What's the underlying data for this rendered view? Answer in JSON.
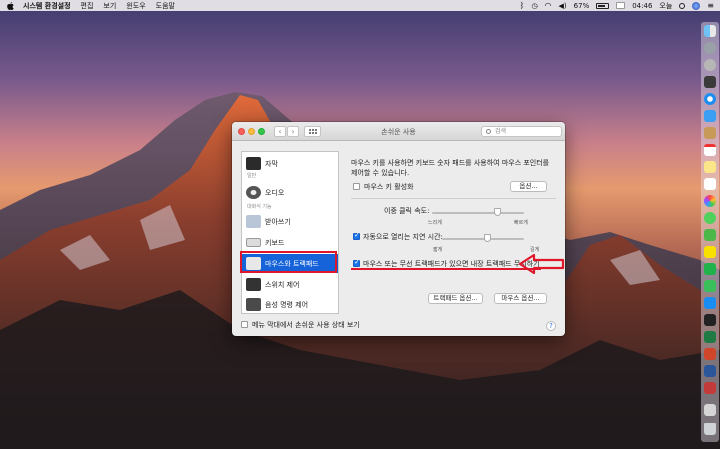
{
  "menubar": {
    "app_name": "시스템 환경설정",
    "items": [
      "편집",
      "보기",
      "윈도우",
      "도움말"
    ],
    "battery": "67%",
    "time": "04:46",
    "user": "오늘"
  },
  "window": {
    "title": "손쉬운 사용",
    "search_placeholder": "검색",
    "sidebar": {
      "group_general": "일반",
      "group_interaction": "대화식 기능",
      "items": [
        "자막",
        "오디오",
        "받아쓰기",
        "키보드",
        "마우스와 트랙패드",
        "스위치 제어",
        "음성 명령 제어"
      ],
      "selected": "마우스와 트랙패드",
      "footer_checkbox": "메뉴 막대에서 손쉬운 사용 상태 보기"
    },
    "panel": {
      "description": "마우스 키를 사용하면 키보드 숫자 패드를 사용하여 마우스 포인터를 제어할 수 있습니다.",
      "mouse_keys_label": "마우스 키 활성화",
      "mouse_keys_checked": false,
      "options_button": "옵션...",
      "double_click_label": "이중 클릭 속도:",
      "double_click_slow": "느리게",
      "double_click_fast": "빠르게",
      "double_click_value": 0.65,
      "spring_loading_label": "자동으로 열리는 지연 시간:",
      "spring_loading_checked": true,
      "spring_short": "짧게",
      "spring_long": "길게",
      "spring_value": 0.55,
      "ignore_trackpad_label": "마우스 또는 무선 트랙패드가 있으면 내장 트랙패드 무시하기",
      "ignore_trackpad_checked": true,
      "trackpad_options_button": "트랙패드 옵션...",
      "mouse_options_button": "마우스 옵션...",
      "help_button": "?"
    }
  },
  "colors": {
    "selection": "#1663d9",
    "annotation": "#e0162a",
    "checkbox_on": "#1a76e8"
  }
}
